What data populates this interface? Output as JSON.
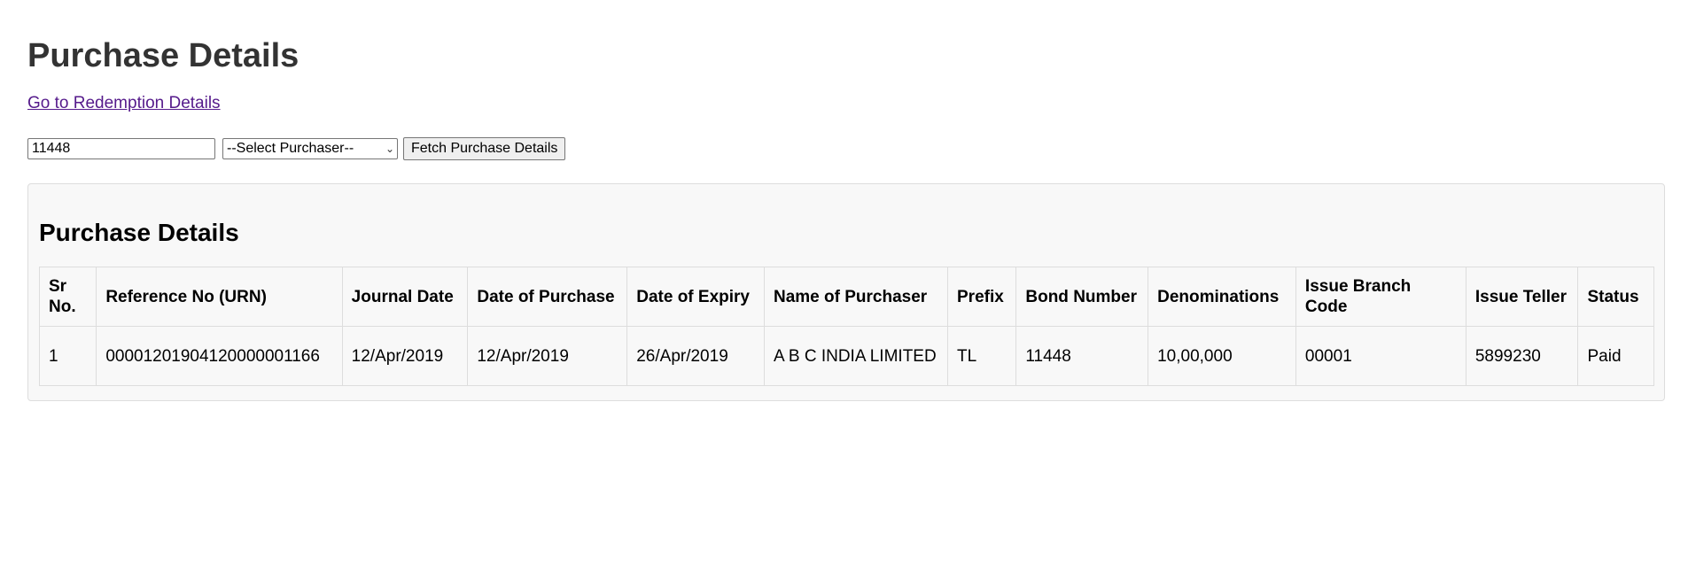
{
  "page": {
    "title": "Purchase Details",
    "nav_link": "Go to Redemption Details"
  },
  "controls": {
    "urn_input_value": "11448",
    "purchaser_select_value": "--Select Purchaser--",
    "fetch_button_label": "Fetch Purchase Details"
  },
  "panel": {
    "title": "Purchase Details",
    "columns": [
      "Sr No.",
      "Reference No (URN)",
      "Journal Date",
      "Date of Purchase",
      "Date of Expiry",
      "Name of Purchaser",
      "Prefix",
      "Bond Number",
      "Denominations",
      "Issue Branch Code",
      "Issue Teller",
      "Status"
    ],
    "rows": [
      [
        "1",
        "00001201904120000001166",
        "12/Apr/2019",
        "12/Apr/2019",
        "26/Apr/2019",
        "A B C INDIA LIMITED",
        "TL",
        "11448",
        "10,00,000",
        "00001",
        "5899230",
        "Paid"
      ]
    ]
  }
}
